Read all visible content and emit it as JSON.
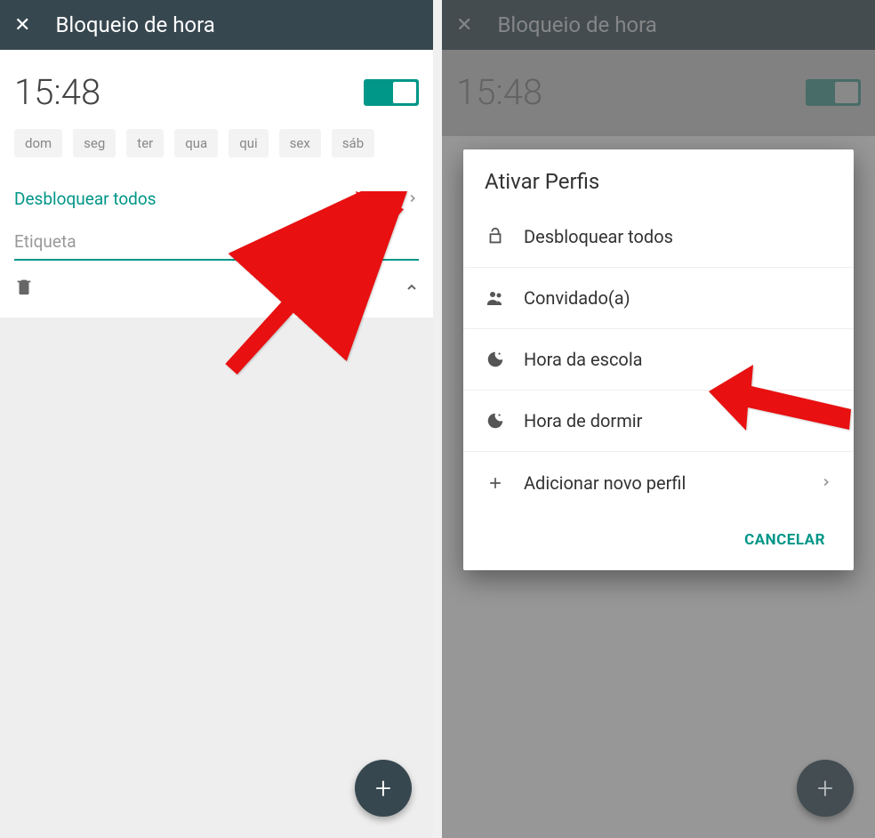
{
  "left": {
    "appbar": {
      "title": "Bloqueio de hora"
    },
    "time": "15:48",
    "days": [
      "dom",
      "seg",
      "ter",
      "qua",
      "qui",
      "sex",
      "sáb"
    ],
    "profile_link": "Desbloquear todos",
    "etiqueta_placeholder": "Etiqueta"
  },
  "right": {
    "appbar": {
      "title": "Bloqueio de hora"
    },
    "time": "15:48",
    "dialog": {
      "title": "Ativar Perfis",
      "items": [
        {
          "label": "Desbloquear todos",
          "icon": "unlock"
        },
        {
          "label": "Convidado(a)",
          "icon": "people"
        },
        {
          "label": "Hora da escola",
          "icon": "moon"
        },
        {
          "label": "Hora de dormir",
          "icon": "moon"
        },
        {
          "label": "Adicionar novo perfil",
          "icon": "plus",
          "chevron": true
        }
      ],
      "cancel": "CANCELAR"
    }
  }
}
